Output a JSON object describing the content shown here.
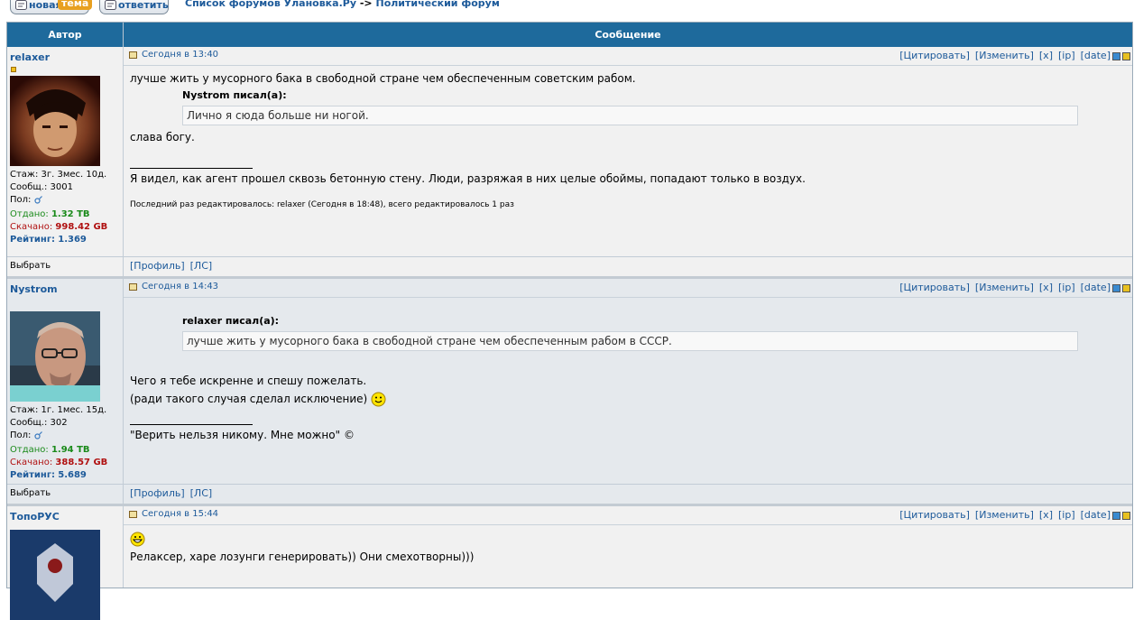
{
  "toolbar": {
    "new_topic_label_1": "новая",
    "new_topic_label_2": "тема",
    "reply_label": "ответить"
  },
  "breadcrumb": {
    "forum_list": "Список форумов Улановка.Ру",
    "separator": "->",
    "current": "Политический форум"
  },
  "table_header": {
    "author": "Автор",
    "message": "Сообщение"
  },
  "post_actions": {
    "quote": "[Цитировать]",
    "edit": "[Изменить]",
    "delete": "[x]",
    "ip": "[ip]",
    "date": "[date]"
  },
  "footer_actions": {
    "select": "Выбрать",
    "profile": "[Профиль]",
    "pm": "[ЛС]"
  },
  "posts": [
    {
      "author": "relaxer",
      "stats": {
        "tenure": "Стаж: 3г. 3мес. 10д.",
        "messages": "Сообщ.: 3001",
        "gender_label": "Пол:",
        "uploaded_label": "Отдано:",
        "uploaded": "1.32 TB",
        "downloaded_label": "Скачано:",
        "downloaded": "998.42 GB",
        "rating_label": "Рейтинг:",
        "rating": "1.369"
      },
      "date": "Сегодня в 13:40",
      "text_1": "лучше жить у мусорного бака в свободной стране чем обеспеченным советским рабом.",
      "quote_author": "Nystrom писал(а):",
      "quote_text": "Лично я сюда больше ни ногой.",
      "text_2": "слава богу.",
      "signature": "Я видел, как агент прошел сквозь бетонную стену. Люди, разряжая в них целые обоймы, попадают только в воздух.",
      "edited": "Последний раз редактировалось: relaxer (Сегодня в 18:48), всего редактировалось 1 раз"
    },
    {
      "author": "Nystrom",
      "stats": {
        "tenure": "Стаж: 1г. 1мес. 15д.",
        "messages": "Сообщ.: 302",
        "gender_label": "Пол:",
        "uploaded_label": "Отдано:",
        "uploaded": "1.94 TB",
        "downloaded_label": "Скачано:",
        "downloaded": "388.57 GB",
        "rating_label": "Рейтинг:",
        "rating": "5.689"
      },
      "date": "Сегодня в 14:43",
      "quote_author": "relaxer писал(а):",
      "quote_text": "лучше жить у мусорного бака в свободной стране чем обеспеченным рабом в СССР.",
      "text_1": "Чего я тебе искренне и спешу пожелать.",
      "text_2": "(ради такого случая сделал исключение)",
      "signature": "\"Верить нельзя никому. Мне можно\" ©"
    },
    {
      "author": "ТопоРУС",
      "date": "Сегодня в 15:44",
      "text_1": "Релаксер, харе лозунги генерировать)) Они смехотворны)))"
    }
  ]
}
